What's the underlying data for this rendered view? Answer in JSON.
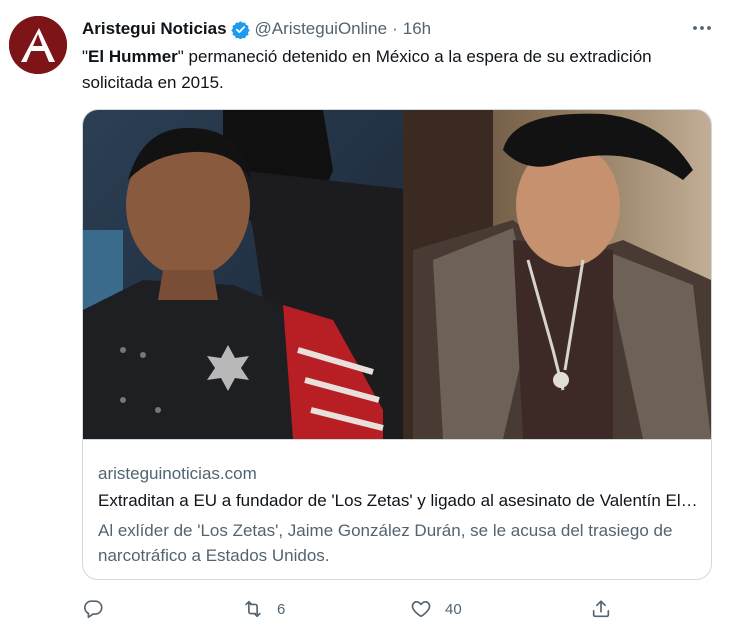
{
  "account": {
    "display_name": "Aristegui Noticias",
    "handle": "@AristeguiOnline",
    "separator": "·",
    "time": "16h",
    "verified_icon": "verified-badge-icon",
    "avatar_letter": "A"
  },
  "tweet": {
    "text_open_quote": "\"",
    "text_bold": "El Hummer",
    "text_rest": "\" permaneció detenido en México a la espera de su extradición solicitada en 2015."
  },
  "card": {
    "domain": "aristeguinoticias.com",
    "title": "Extraditan a EU a fundador de 'Los Zetas' y ligado al asesinato de Valentín Elizalde",
    "description": "Al exlíder de 'Los Zetas', Jaime González Durán, se le acusa del trasiego de narcotráfico a Estados Unidos."
  },
  "actions": {
    "reply_icon": "reply-icon",
    "retweet_icon": "retweet-icon",
    "retweet_count": "6",
    "like_icon": "heart-icon",
    "like_count": "40",
    "share_icon": "share-icon"
  },
  "colors": {
    "text_primary": "#0f1419",
    "text_secondary": "#536471",
    "border": "#cfd9de",
    "verified_blue": "#1d9bf0",
    "avatar_red": "#7d1418"
  }
}
